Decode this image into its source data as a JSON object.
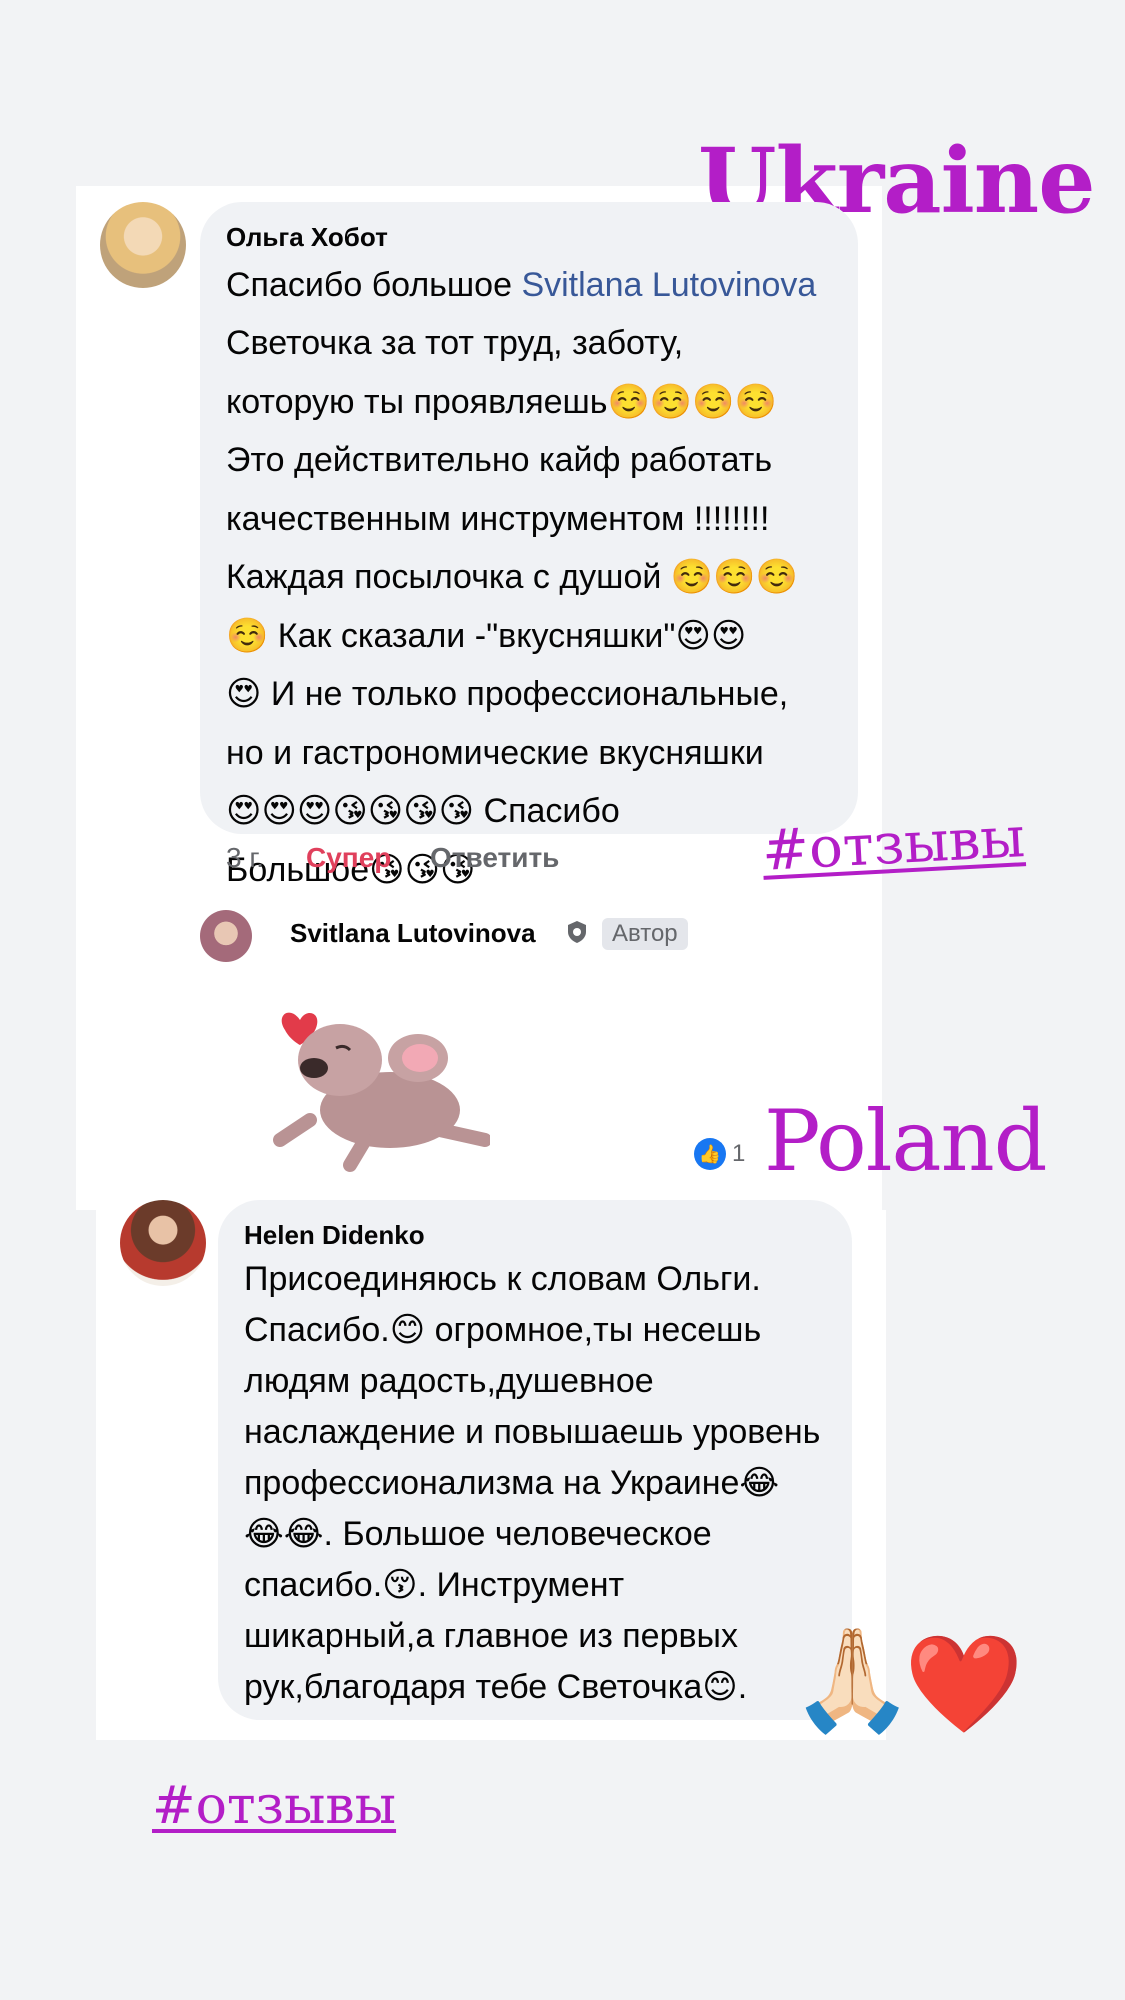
{
  "overlays": {
    "ukraine_label": "Ukraine",
    "poland_label": "Poland",
    "hashtag_top": "#отзывы",
    "hashtag_bottom": "#отзывы"
  },
  "comment1": {
    "author": "Ольга Хобот",
    "lines": [
      {
        "pre": "Спасибо большое ",
        "mention": "Svitlana Lutovinova"
      },
      {
        "text": "Светочка за тот труд, заботу,"
      },
      {
        "text": "которую ты проявляешь☺️☺️☺️☺️"
      },
      {
        "text": "Это действительно кайф работать"
      },
      {
        "text": "качественным инструментом !!!!!!!!"
      },
      {
        "text": "Каждая посылочка с душой ☺️☺️☺️"
      },
      {
        "text": "☺️ Как сказали -\"вкусняшки\"😍😍"
      },
      {
        "text": "😍 И не только профессиональные,"
      },
      {
        "text": "но и гастрономические вкусняшки"
      },
      {
        "text": "😍😍😍😘😘😘😘 Спасибо"
      },
      {
        "text": "Большое😘😘😘"
      }
    ],
    "meta": {
      "time": "3 г.",
      "reaction": "Супер",
      "reply": "Ответить"
    }
  },
  "reply1": {
    "author": "Svitlana Lutovinova",
    "badge": "Автор",
    "like_count": "1"
  },
  "comment2": {
    "author": "Helen Didenko",
    "lines": [
      {
        "text": "Присоединяюсь к словам Ольги."
      },
      {
        "text": "Спасибо.😊 огромное,ты несешь"
      },
      {
        "text": "людям радость,душевное"
      },
      {
        "text": "наслаждение и повышаешь уровень"
      },
      {
        "text": "профессионализма на Украине😂"
      },
      {
        "text": "😂😂. Большое человеческое"
      },
      {
        "text": "спасибо.😚. Инструмент"
      },
      {
        "text": "шикарный,а главное из первых"
      },
      {
        "text": "рук,благодаря тебе Светочка😊."
      }
    ]
  },
  "decor": {
    "pray_emoji": "🙏🏻",
    "heart_emoji": "❤️",
    "sticker_heart": "❤"
  },
  "colors": {
    "accent_purple": "#b31ec7",
    "reaction_red": "#e0405c",
    "mention_blue": "#385898",
    "like_blue": "#1877f2"
  }
}
